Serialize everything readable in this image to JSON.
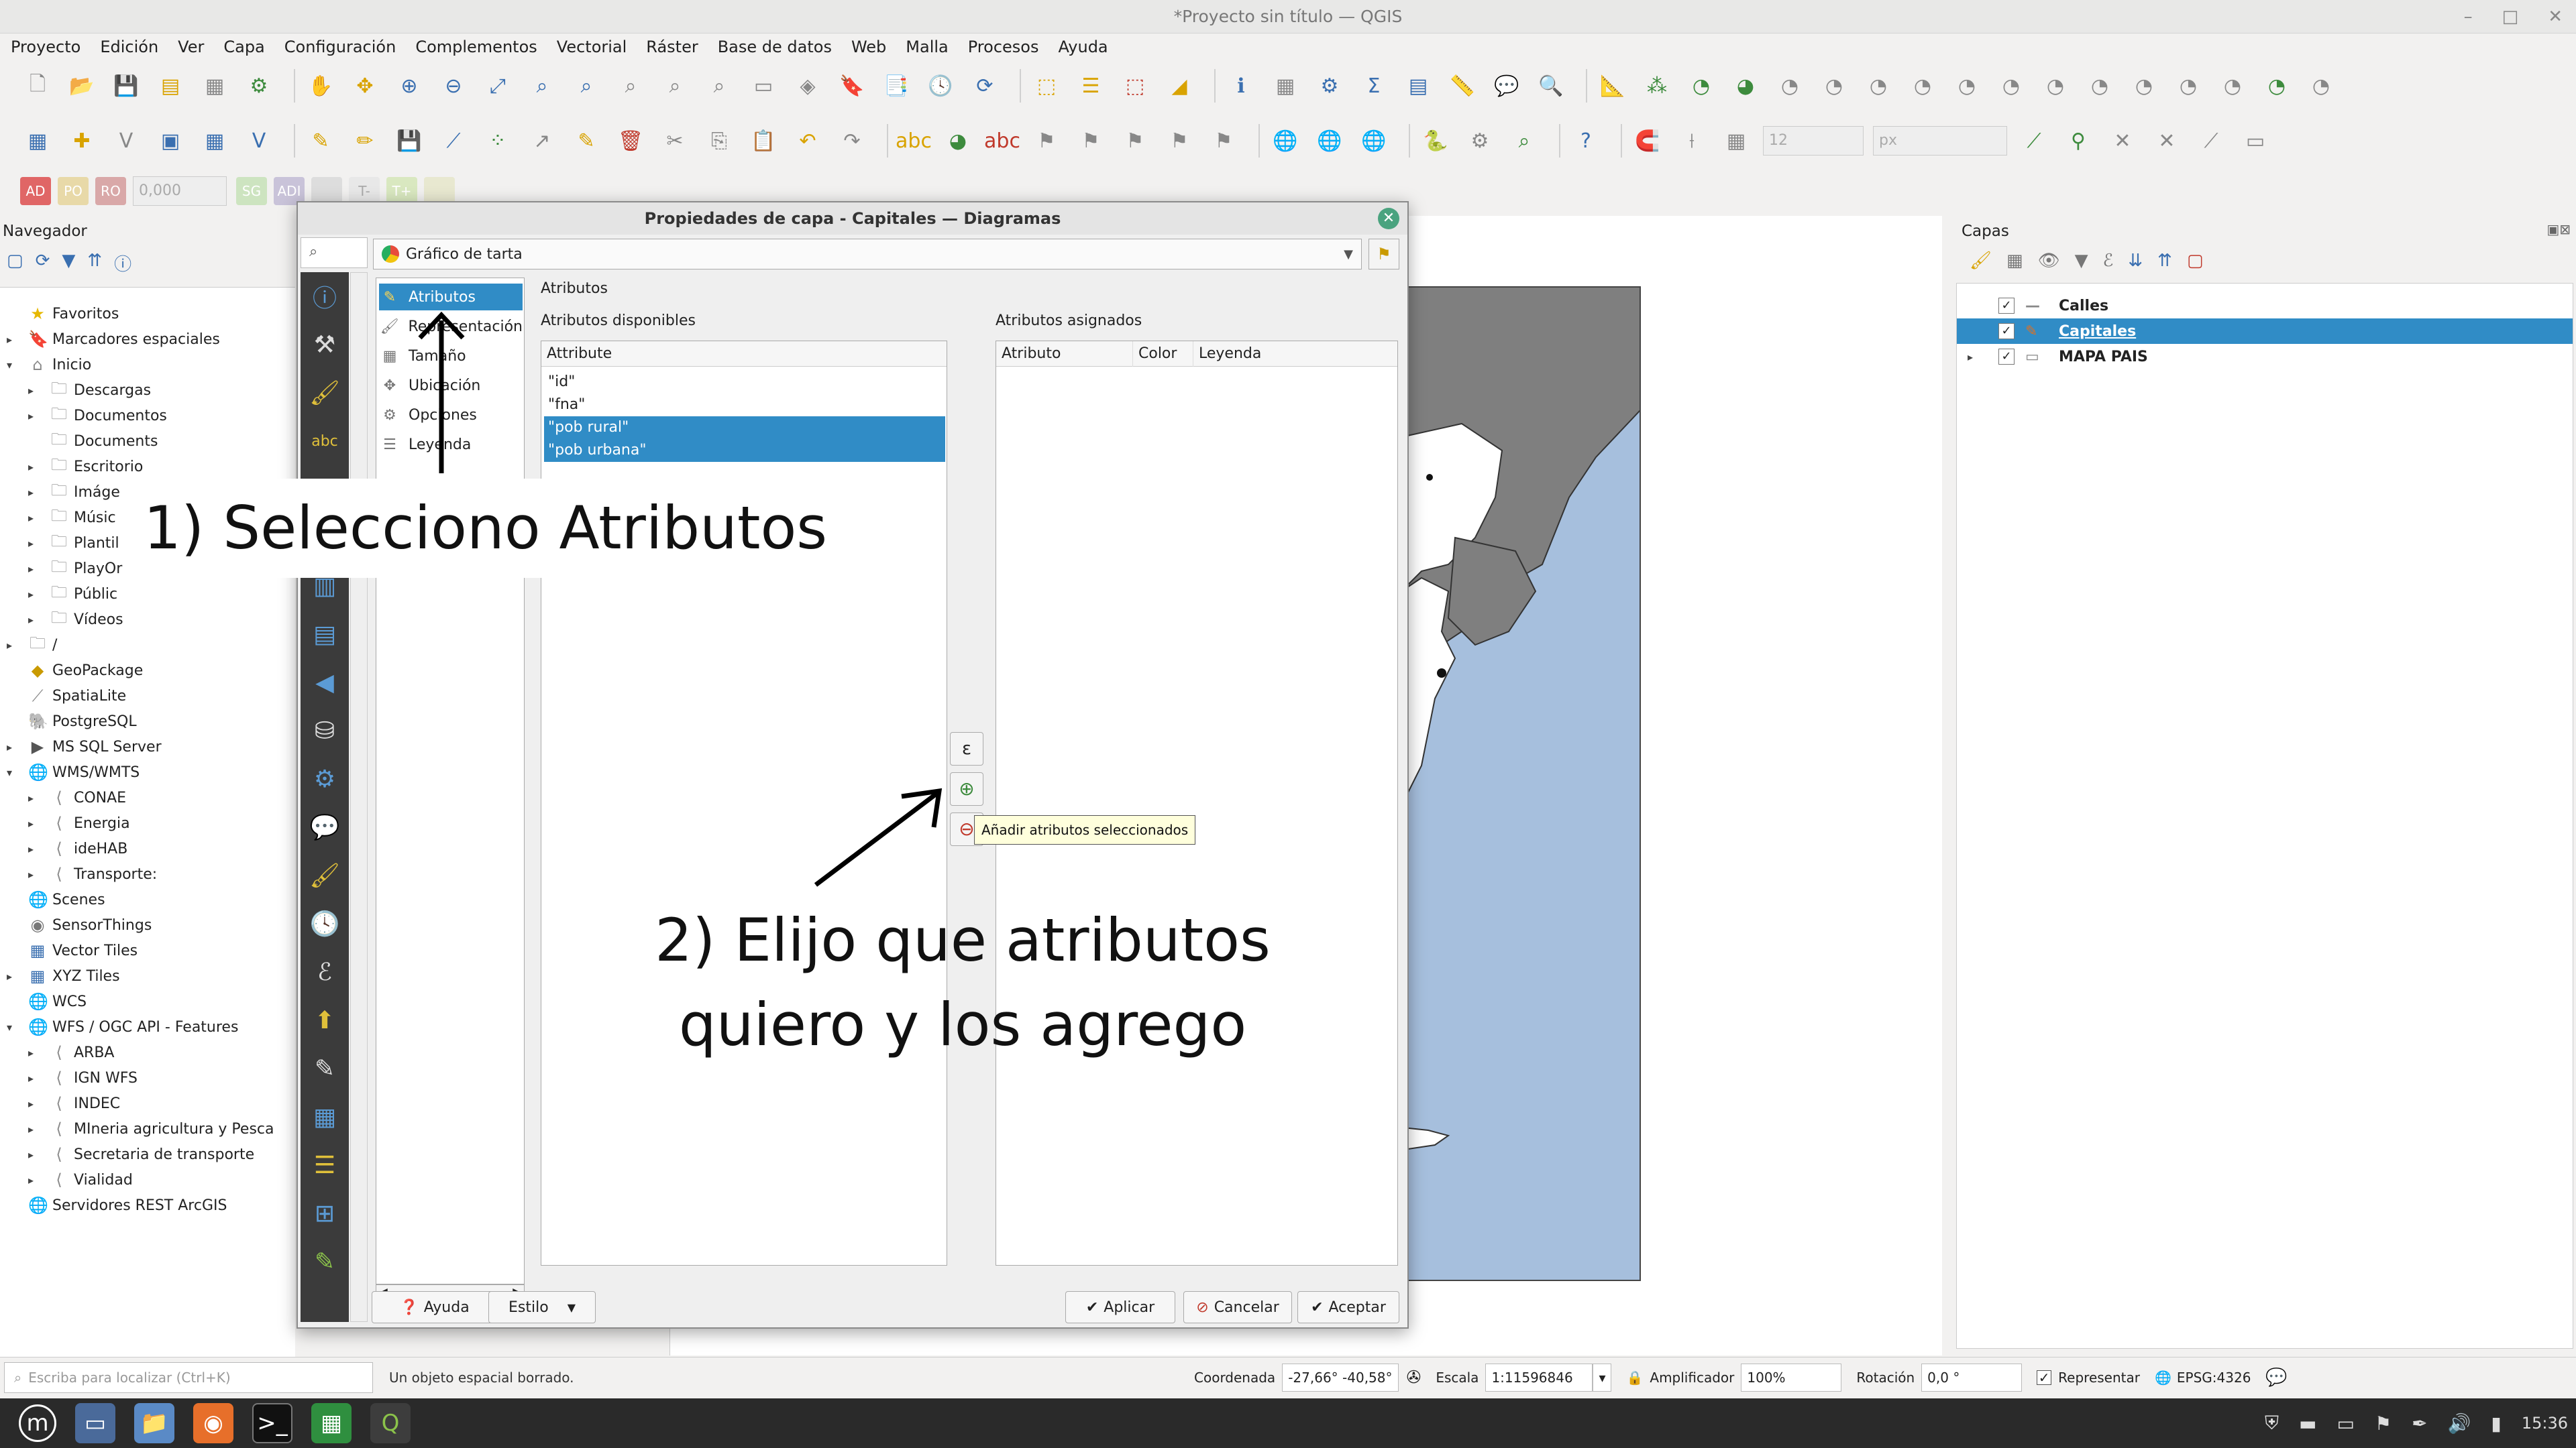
{
  "window": {
    "title": "*Proyecto sin título — QGIS"
  },
  "menu": [
    "Proyecto",
    "Edición",
    "Ver",
    "Capa",
    "Configuración",
    "Complementos",
    "Vectorial",
    "Ráster",
    "Base de datos",
    "Web",
    "Malla",
    "Procesos",
    "Ayuda"
  ],
  "toolbar3": {
    "ad": "AD",
    "po": "PO",
    "ro": "RO",
    "value": "0,000",
    "sg": "SG",
    "ae": "ADI"
  },
  "toolbar2": {
    "size": "12",
    "unit": "px"
  },
  "navigator": {
    "title": "Navegador",
    "items": [
      {
        "label": "Favoritos",
        "icon": "star-icon",
        "level": 0,
        "expander": ""
      },
      {
        "label": "Marcadores espaciales",
        "icon": "bookmark-icon",
        "level": 0,
        "expander": "▸"
      },
      {
        "label": "Inicio",
        "icon": "home-icon",
        "level": 0,
        "expander": "▾"
      },
      {
        "label": "Descargas",
        "icon": "folder-icon",
        "level": 1,
        "expander": "▸"
      },
      {
        "label": "Documentos",
        "icon": "folder-icon",
        "level": 1,
        "expander": "▸"
      },
      {
        "label": "Documents",
        "icon": "folder-icon",
        "level": 1,
        "expander": ""
      },
      {
        "label": "Escritorio",
        "icon": "folder-icon",
        "level": 1,
        "expander": "▸"
      },
      {
        "label": "Imáge",
        "icon": "folder-icon",
        "level": 1,
        "expander": "▸"
      },
      {
        "label": "Músic",
        "icon": "folder-icon",
        "level": 1,
        "expander": "▸"
      },
      {
        "label": "Plantil",
        "icon": "folder-icon",
        "level": 1,
        "expander": "▸"
      },
      {
        "label": "PlayOr",
        "icon": "folder-icon",
        "level": 1,
        "expander": "▸"
      },
      {
        "label": "Públic",
        "icon": "folder-icon",
        "level": 1,
        "expander": "▸"
      },
      {
        "label": "Vídeos",
        "icon": "folder-icon",
        "level": 1,
        "expander": "▸"
      },
      {
        "label": "/",
        "icon": "folder-icon",
        "level": 0,
        "expander": "▸"
      },
      {
        "label": "GeoPackage",
        "icon": "geopackage-icon",
        "level": 0,
        "expander": ""
      },
      {
        "label": "SpatiaLite",
        "icon": "spatialite-icon",
        "level": 0,
        "expander": ""
      },
      {
        "label": "PostgreSQL",
        "icon": "postgresql-icon",
        "level": 0,
        "expander": ""
      },
      {
        "label": "MS SQL Server",
        "icon": "mssql-icon",
        "level": 0,
        "expander": "▸"
      },
      {
        "label": "WMS/WMTS",
        "icon": "globe-icon",
        "level": 0,
        "expander": "▾"
      },
      {
        "label": "CONAE",
        "icon": "wms-connection-icon",
        "level": 1,
        "expander": "▸"
      },
      {
        "label": "Energia",
        "icon": "wms-connection-icon",
        "level": 1,
        "expander": "▸"
      },
      {
        "label": "ideHAB",
        "icon": "wms-connection-icon",
        "level": 1,
        "expander": "▸"
      },
      {
        "label": "Transporte:",
        "icon": "wms-connection-icon",
        "level": 1,
        "expander": "▸"
      },
      {
        "label": "Scenes",
        "icon": "globe-icon",
        "level": 0,
        "expander": ""
      },
      {
        "label": "SensorThings",
        "icon": "sensor-icon",
        "level": 0,
        "expander": ""
      },
      {
        "label": "Vector Tiles",
        "icon": "grid-icon",
        "level": 0,
        "expander": ""
      },
      {
        "label": "XYZ Tiles",
        "icon": "grid-icon",
        "level": 0,
        "expander": "▸"
      },
      {
        "label": "WCS",
        "icon": "globe-icon",
        "level": 0,
        "expander": ""
      },
      {
        "label": "WFS / OGC API - Features",
        "icon": "globe-icon",
        "level": 0,
        "expander": "▾"
      },
      {
        "label": "ARBA",
        "icon": "wms-connection-icon",
        "level": 1,
        "expander": "▸"
      },
      {
        "label": "IGN WFS",
        "icon": "wms-connection-icon",
        "level": 1,
        "expander": "▸"
      },
      {
        "label": "INDEC",
        "icon": "wms-connection-icon",
        "level": 1,
        "expander": "▸"
      },
      {
        "label": "MIneria agricultura y Pesca",
        "icon": "wms-connection-icon",
        "level": 1,
        "expander": "▸"
      },
      {
        "label": "Secretaria de transporte",
        "icon": "wms-connection-icon",
        "level": 1,
        "expander": "▸"
      },
      {
        "label": "Vialidad",
        "icon": "wms-connection-icon",
        "level": 1,
        "expander": "▸"
      },
      {
        "label": "Servidores REST ArcGIS",
        "icon": "globe-icon",
        "level": 0,
        "expander": ""
      }
    ]
  },
  "layers": {
    "title": "Capas",
    "items": [
      {
        "name": "Calles",
        "checked": "✓",
        "selected": false,
        "icon": "line-layer-icon"
      },
      {
        "name": "Capitales",
        "checked": "✓",
        "selected": true,
        "icon": "point-layer-icon"
      },
      {
        "name": "MAPA PAIS",
        "checked": "✓",
        "selected": false,
        "icon": "polygon-layer-icon"
      }
    ]
  },
  "dialog": {
    "title": "Propiedades de capa - Capitales — Diagramas",
    "diagram_type": "Gráfico de tarta",
    "sections": [
      {
        "label": "Atributos",
        "icon": "attributes-icon"
      },
      {
        "label": "Representación",
        "icon": "rendering-icon"
      },
      {
        "label": "Tamaño",
        "icon": "size-icon"
      },
      {
        "label": "Ubicación",
        "icon": "placement-icon"
      },
      {
        "label": "Opciones",
        "icon": "options-icon"
      },
      {
        "label": "Leyenda",
        "icon": "legend-icon"
      }
    ],
    "section_title": "Atributos",
    "available_label": "Atributos disponibles",
    "assigned_label": "Atributos asignados",
    "available_header": "Attribute",
    "available": [
      {
        "name": "\"id\"",
        "selected": false
      },
      {
        "name": "\"fna\"",
        "selected": false
      },
      {
        "name": "\"pob rural\"",
        "selected": true
      },
      {
        "name": "\"pob urbana\"",
        "selected": true
      }
    ],
    "assigned_headers": [
      "Atributo",
      "Color",
      "Leyenda"
    ],
    "tooltip": "Añadir atributos seleccionados",
    "buttons": {
      "help": "Ayuda",
      "style": "Estilo",
      "apply": "Aplicar",
      "cancel": "Cancelar",
      "ok": "Aceptar"
    }
  },
  "status": {
    "locator_placeholder": "Escriba para localizar (Ctrl+K)",
    "message": "Un objeto espacial borrado.",
    "coord_label": "Coordenada",
    "coord_value": "-27,66° -40,58°",
    "scale_label": "Escala",
    "scale_value": "1:11596846",
    "magnifier_label": "Amplificador",
    "magnifier_value": "100%",
    "rotation_label": "Rotación",
    "rotation_value": "0,0 °",
    "render_label": "Representar",
    "crs": "EPSG:4326"
  },
  "taskbar": {
    "clock": "15:36"
  },
  "annotations": {
    "step1": "1) Selecciono Atributos",
    "step2_line1": "2) Elijo que atributos",
    "step2_line2": "quiero y los agrego"
  },
  "colors": {
    "selection": "#308cc6",
    "sea": "#a6bfdd",
    "land_gray": "#7f7f7f",
    "land_white": "#ffffff"
  }
}
